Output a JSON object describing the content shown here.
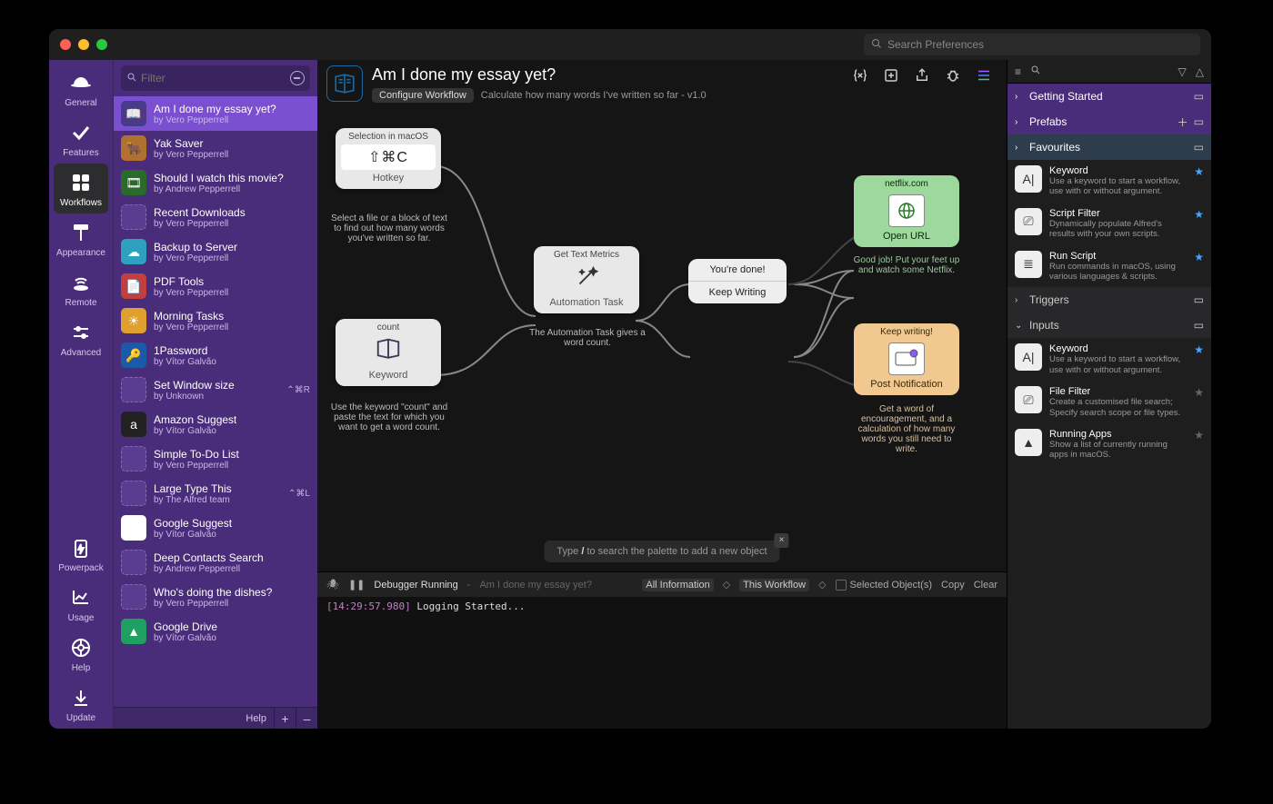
{
  "titlebar": {
    "search_placeholder": "Search Preferences"
  },
  "rail": [
    {
      "label": "General"
    },
    {
      "label": "Features"
    },
    {
      "label": "Workflows"
    },
    {
      "label": "Appearance"
    },
    {
      "label": "Remote"
    },
    {
      "label": "Advanced"
    }
  ],
  "rail_bottom": [
    {
      "label": "Powerpack"
    },
    {
      "label": "Usage"
    },
    {
      "label": "Help"
    },
    {
      "label": "Update"
    }
  ],
  "filter_placeholder": "Filter",
  "workflows": [
    {
      "title": "Am I done my essay yet?",
      "author": "by Vero Pepperrell",
      "selected": true,
      "shortcut": "",
      "icon": "book"
    },
    {
      "title": "Yak Saver",
      "author": "by Vero Pepperrell",
      "icon": "yak"
    },
    {
      "title": "Should I watch this movie?",
      "author": "by Andrew Pepperrell",
      "icon": "movie"
    },
    {
      "title": "Recent Downloads",
      "author": "by Vero Pepperrell",
      "icon": "placeholder"
    },
    {
      "title": "Backup to Server",
      "author": "by Vero Pepperrell",
      "icon": "cloud"
    },
    {
      "title": "PDF Tools",
      "author": "by Vero Pepperrell",
      "icon": "pdf"
    },
    {
      "title": "Morning Tasks",
      "author": "by Vero Pepperrell",
      "icon": "sun"
    },
    {
      "title": "1Password",
      "author": "by Vítor Galvão",
      "icon": "1p"
    },
    {
      "title": "Set Window size",
      "author": "by Unknown",
      "shortcut": "⌃⌘R",
      "icon": "placeholder"
    },
    {
      "title": "Amazon Suggest",
      "author": "by Vítor Galvão",
      "icon": "amazon"
    },
    {
      "title": "Simple To-Do List",
      "author": "by Vero Pepperrell",
      "icon": "placeholder"
    },
    {
      "title": "Large Type This",
      "author": "by The Alfred team",
      "shortcut": "⌃⌘L",
      "icon": "placeholder"
    },
    {
      "title": "Google Suggest",
      "author": "by Vítor Galvão",
      "icon": "google"
    },
    {
      "title": "Deep Contacts Search",
      "author": "by Andrew Pepperrell",
      "icon": "placeholder"
    },
    {
      "title": "Who's doing the dishes?",
      "author": "by Vero Pepperrell",
      "icon": "placeholder"
    },
    {
      "title": "Google Drive",
      "author": "by Vítor Galvão",
      "icon": "gdrive"
    }
  ],
  "wf_footer": {
    "help": "Help",
    "add": "+",
    "remove": "–"
  },
  "header": {
    "title": "Am I done my essay yet?",
    "configure": "Configure Workflow",
    "desc": "Calculate how many words I've written so far - v1.0"
  },
  "canvas": {
    "hotkey": {
      "top": "Selection in macOS",
      "combo": "⇧⌘C",
      "lbl": "Hotkey",
      "desc": "Select a file or a block of text to find out how many words you've written so far."
    },
    "keyword": {
      "top": "count",
      "lbl": "Keyword",
      "desc": "Use the keyword \"count\" and paste the text for which you want to get a word count."
    },
    "task": {
      "top": "Get Text Metrics",
      "lbl": "Automation Task",
      "desc": "The Automation Task gives a word count."
    },
    "decision": {
      "a": "You're done!",
      "b": "Keep Writing"
    },
    "openurl": {
      "top": "netflix.com",
      "lbl": "Open URL",
      "desc": "Good job! Put your feet up and watch some Netflix."
    },
    "notify": {
      "top": "Keep writing!",
      "lbl": "Post Notification",
      "desc": "Get a word of encouragement, and a calculation of how many words you still need to write."
    }
  },
  "palette_hint_pre": "Type ",
  "palette_hint_key": "/",
  "palette_hint_post": " to search the palette to add a new object",
  "palette": {
    "sections": [
      {
        "label": "Getting Started",
        "kind": "purple"
      },
      {
        "label": "Prefabs",
        "kind": "purple",
        "add": true
      },
      {
        "label": "Favourites",
        "kind": "sel"
      }
    ],
    "favourites": [
      {
        "title": "Keyword",
        "desc": "Use a keyword to start a workflow, use with or without argument.",
        "star": true,
        "ic": "A|"
      },
      {
        "title": "Script Filter",
        "desc": "Dynamically populate Alfred's results with your own scripts.",
        "star": true,
        "ic": "⎚"
      },
      {
        "title": "Run Script",
        "desc": "Run commands in macOS, using various languages & scripts.",
        "star": true,
        "ic": "≣"
      }
    ],
    "sections2": [
      {
        "label": "Triggers",
        "kind": "dark"
      },
      {
        "label": "Inputs",
        "kind": "dark",
        "open": true
      }
    ],
    "inputs": [
      {
        "title": "Keyword",
        "desc": "Use a keyword to start a workflow, use with or without argument.",
        "star": true,
        "ic": "A|"
      },
      {
        "title": "File Filter",
        "desc": "Create a customised file search; Specify search scope or file types.",
        "star": false,
        "ic": "⎚"
      },
      {
        "title": "Running Apps",
        "desc": "Show a list of currently running apps in macOS.",
        "star": false,
        "ic": "▲"
      }
    ]
  },
  "debugger": {
    "label": "Debugger Running",
    "sub": "Am I done my essay yet?",
    "info": "All Information",
    "scope": "This Workflow",
    "selected": "Selected Object(s)",
    "copy": "Copy",
    "clear": "Clear",
    "ts": "[14:29:57.980]",
    "msg": "Logging Started..."
  }
}
